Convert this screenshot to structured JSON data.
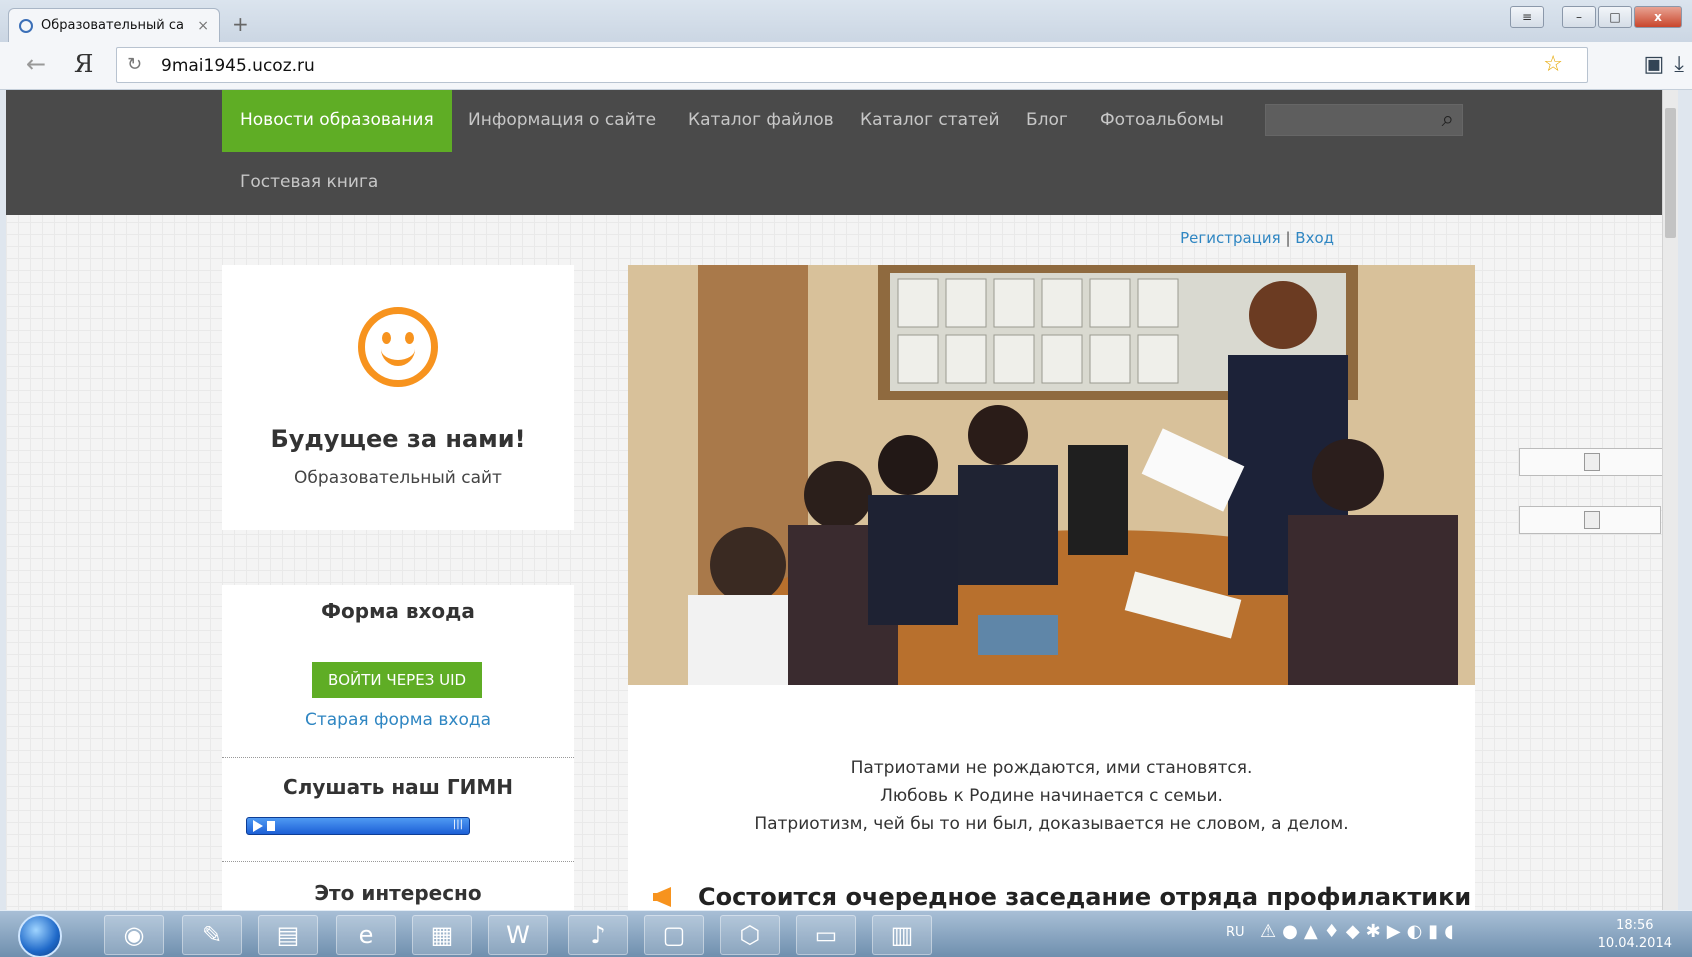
{
  "browser": {
    "tab_title": "Образовательный са",
    "tab_close": "×",
    "new_tab": "+",
    "url": "9mai1945.ucoz.ru",
    "back_icon": "←",
    "ya_label": "Я",
    "reload_icon": "↻",
    "star_icon": "☆"
  },
  "nav": {
    "items": [
      {
        "label": "Новости образования"
      },
      {
        "label": "Информация о сайте"
      },
      {
        "label": "Каталог файлов"
      },
      {
        "label": "Каталог статей"
      },
      {
        "label": "Блог"
      },
      {
        "label": "Фотоальбомы"
      },
      {
        "label": "Гостевая книга"
      }
    ],
    "search_icon": "⌕"
  },
  "auth": {
    "register": "Регистрация",
    "separator": "|",
    "login": "Вход"
  },
  "site_card": {
    "title": "Будущее за нами!",
    "subtitle": "Образовательный сайт"
  },
  "login_form": {
    "title": "Форма входа",
    "uid_button": "ВОЙТИ ЧЕРЕЗ UID",
    "old_form_link": "Старая форма входа",
    "anthem_title": "Слушать наш ГИМН",
    "interesting_title": "Это интересно"
  },
  "main": {
    "quotes": [
      "Патриотами не рождаются, ими становятся.",
      "Любовь к Родине начинается с семьи.",
      "Патриотизм, чей бы то ни был, доказывается не словом, а делом."
    ],
    "post_title": "Состоится очередное заседание отряда профилактики"
  },
  "taskbar": {
    "lang": "RU",
    "time": "18:56",
    "date": "10.04.2014"
  },
  "colors": {
    "accent": "#5fad25",
    "nav_bg": "#4a4a4a",
    "link": "#2f86c2",
    "smile": "#f7931e"
  }
}
